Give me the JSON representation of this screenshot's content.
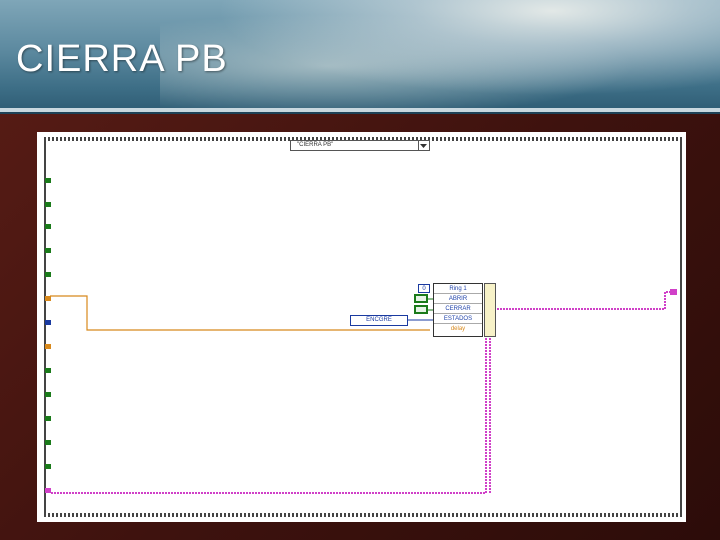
{
  "slide": {
    "title": "CIERRA PB"
  },
  "diagram": {
    "case_selector": "\"CIERRA PB\"",
    "cluster_rows": [
      "Ring 1",
      "ABRIR",
      "CERRAR",
      "ESTADOS",
      "delay"
    ],
    "enum_constant": "ENCGRE",
    "numeric_constant": "0",
    "colors": {
      "orange_wire": "#d8891c",
      "pink_wire": "#d040c8",
      "green_bool": "#1a7a1a",
      "blue_enum": "#1a3aa0",
      "cluster_text": "#2244aa",
      "delay_text": "#d8891c"
    }
  }
}
